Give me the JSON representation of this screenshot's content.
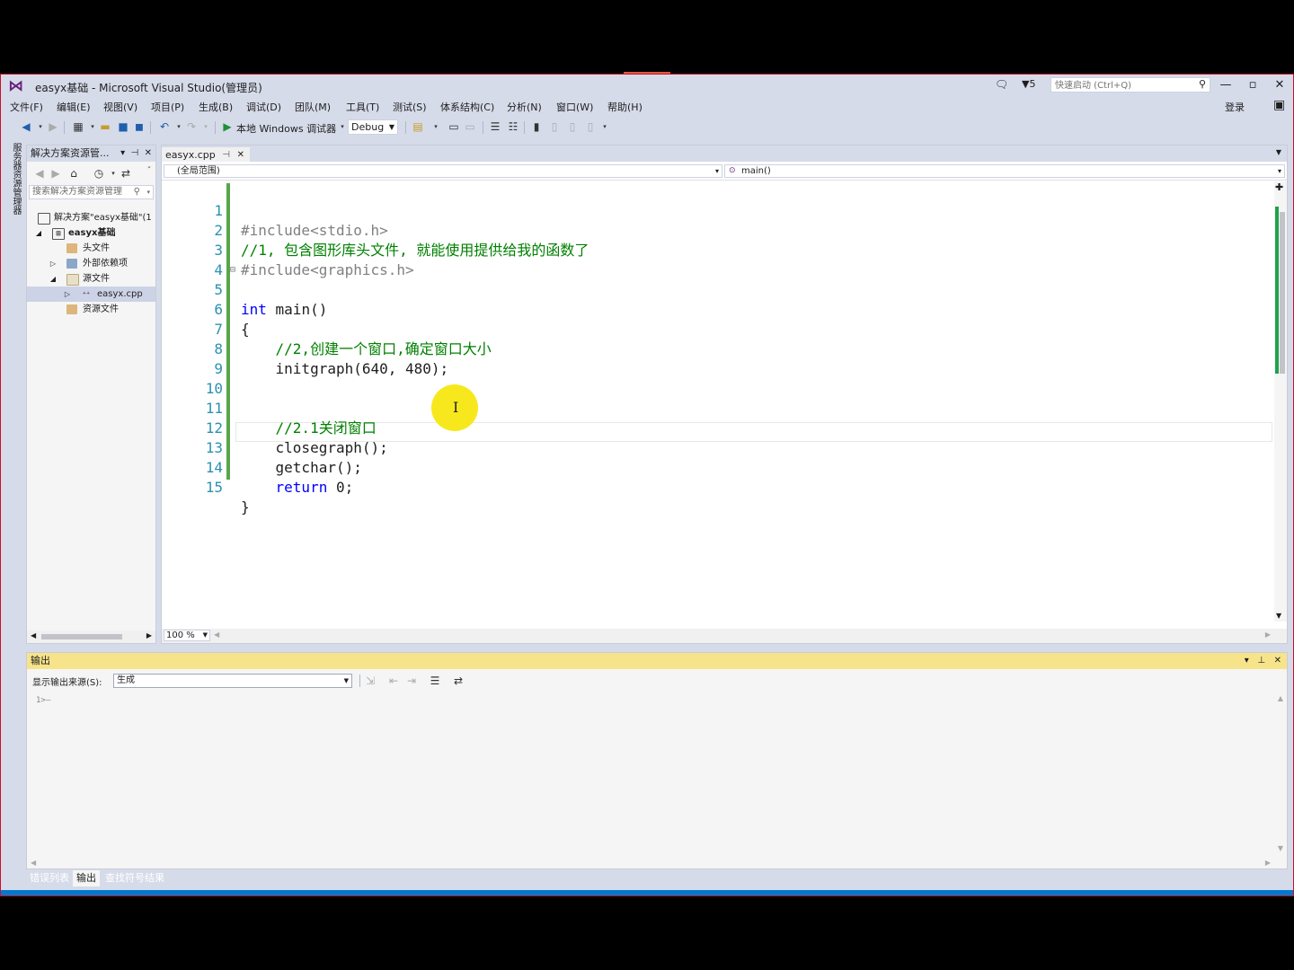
{
  "title": "easyx基础 - Microsoft Visual Studio(管理员)",
  "notifications_count": "5",
  "quick_launch_placeholder": "快速启动 (Ctrl+Q)",
  "login_label": "登录",
  "menu": [
    "文件(F)",
    "编辑(E)",
    "视图(V)",
    "项目(P)",
    "生成(B)",
    "调试(D)",
    "团队(M)",
    "工具(T)",
    "测试(S)",
    "体系结构(C)",
    "分析(N)",
    "窗口(W)",
    "帮助(H)"
  ],
  "toolbar": {
    "run_label": "本地 Windows 调试器",
    "config_value": "Debug"
  },
  "left_strip_text": "服务器资源管理器",
  "solution_explorer": {
    "header": "解决方案资源管...",
    "search_placeholder": "搜索解决方案资源管理",
    "tree": [
      {
        "label": "解决方案\"easyx基础\"(1",
        "bold": false
      },
      {
        "label": "easyx基础",
        "bold": true
      },
      {
        "label": "头文件",
        "bold": false
      },
      {
        "label": "外部依赖项",
        "bold": false
      },
      {
        "label": "源文件",
        "bold": false
      },
      {
        "label": "easyx.cpp",
        "bold": false
      },
      {
        "label": "资源文件",
        "bold": false
      }
    ]
  },
  "editor": {
    "tab_name": "easyx.cpp",
    "scope": "(全局范围)",
    "function": "main()",
    "zoom": "100 %",
    "lines": [
      {
        "n": "1",
        "text": "#include<stdio.h>"
      },
      {
        "n": "2",
        "text": "//1, 包含图形库头文件, 就能使用提供给我的函数了"
      },
      {
        "n": "3",
        "text": "#include<graphics.h>"
      },
      {
        "n": "4",
        "text": ""
      },
      {
        "n": "5",
        "text": "int main()"
      },
      {
        "n": "6",
        "text": "{"
      },
      {
        "n": "7",
        "text": "    //2,创建一个窗口,确定窗口大小"
      },
      {
        "n": "8",
        "text": "    initgraph(640, 480);"
      },
      {
        "n": "9",
        "text": ""
      },
      {
        "n": "10",
        "text": ""
      },
      {
        "n": "11",
        "text": "    //2.1关闭窗口"
      },
      {
        "n": "12",
        "text": "    closegraph();"
      },
      {
        "n": "13",
        "text": "    getchar();"
      },
      {
        "n": "14",
        "text": "    return 0;"
      },
      {
        "n": "15",
        "text": "}"
      }
    ]
  },
  "output": {
    "header": "输出",
    "source_label": "显示输出来源(S):",
    "source_value": "生成",
    "content": "1>—"
  },
  "bottom_tabs": [
    "错误列表",
    "输出",
    "查找符号结果"
  ],
  "colors": {
    "keyword": "#0000ff",
    "comment": "#008000",
    "line_number": "#2b91af",
    "output_header": "#f7e48a",
    "cursor_highlight": "#f7e81d"
  }
}
